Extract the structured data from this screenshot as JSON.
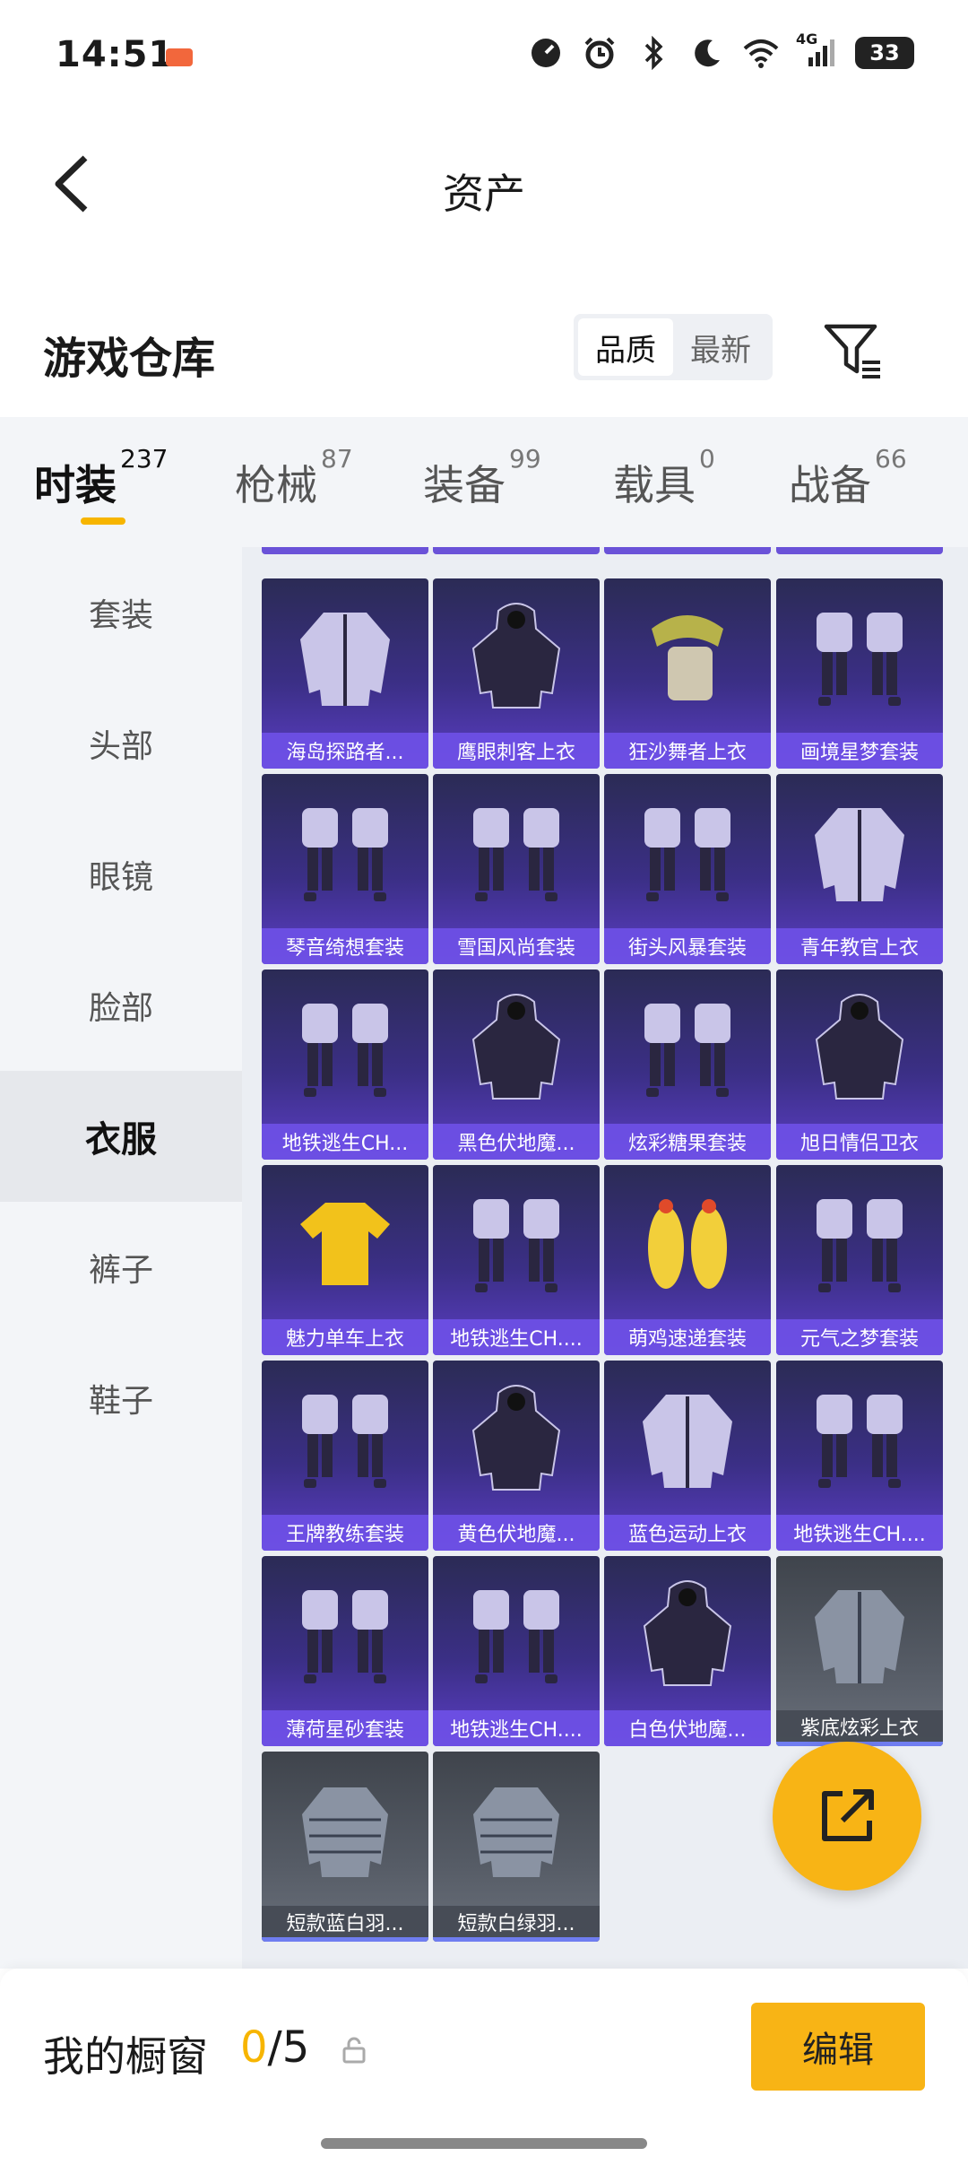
{
  "status_bar": {
    "time": "14:51",
    "network": "4G",
    "battery": "33"
  },
  "nav": {
    "title": "资产"
  },
  "warehouse": {
    "title": "游戏仓库",
    "sort_options": [
      "品质",
      "最新"
    ],
    "sort_active": "品质"
  },
  "tabs": [
    {
      "label": "时装",
      "count": "237",
      "active": true
    },
    {
      "label": "枪械",
      "count": "87",
      "active": false
    },
    {
      "label": "装备",
      "count": "99",
      "active": false
    },
    {
      "label": "载具",
      "count": "0",
      "active": false
    },
    {
      "label": "战备",
      "count": "66",
      "active": false
    }
  ],
  "sidebar": {
    "items": [
      {
        "label": "套装",
        "active": false
      },
      {
        "label": "头部",
        "active": false
      },
      {
        "label": "眼镜",
        "active": false
      },
      {
        "label": "脸部",
        "active": false
      },
      {
        "label": "衣服",
        "active": true
      },
      {
        "label": "裤子",
        "active": false
      },
      {
        "label": "鞋子",
        "active": false
      }
    ]
  },
  "items": [
    {
      "name": "海岛探路者...",
      "icon": "jacket-icon",
      "rarity": "epic"
    },
    {
      "name": "鹰眼刺客上衣",
      "icon": "hoodie-icon",
      "rarity": "epic"
    },
    {
      "name": "狂沙舞者上衣",
      "icon": "scarf-icon",
      "rarity": "epic"
    },
    {
      "name": "画境星梦套装",
      "icon": "outfit-icon",
      "rarity": "epic"
    },
    {
      "name": "琴音绮想套装",
      "icon": "outfit-icon",
      "rarity": "epic"
    },
    {
      "name": "雪国风尚套装",
      "icon": "outfit-icon",
      "rarity": "epic"
    },
    {
      "name": "街头风暴套装",
      "icon": "outfit-icon",
      "rarity": "epic"
    },
    {
      "name": "青年教官上衣",
      "icon": "jacket-icon",
      "rarity": "epic"
    },
    {
      "name": "地铁逃生CH...",
      "icon": "outfit-icon",
      "rarity": "epic"
    },
    {
      "name": "黑色伏地魔...",
      "icon": "hoodie-icon",
      "rarity": "epic"
    },
    {
      "name": "炫彩糖果套装",
      "icon": "outfit-icon",
      "rarity": "epic"
    },
    {
      "name": "旭日情侣卫衣",
      "icon": "hoodie-icon",
      "rarity": "epic"
    },
    {
      "name": "魅力单车上衣",
      "icon": "shirt-icon",
      "rarity": "epic"
    },
    {
      "name": "地铁逃生CH....",
      "icon": "outfit-icon",
      "rarity": "epic"
    },
    {
      "name": "萌鸡速递套装",
      "icon": "chicken-suit-icon",
      "rarity": "epic"
    },
    {
      "name": "元气之梦套装",
      "icon": "outfit-icon",
      "rarity": "epic"
    },
    {
      "name": "王牌教练套装",
      "icon": "outfit-icon",
      "rarity": "epic"
    },
    {
      "name": "黄色伏地魔...",
      "icon": "hoodie-icon",
      "rarity": "epic"
    },
    {
      "name": "蓝色运动上衣",
      "icon": "jacket-icon",
      "rarity": "epic"
    },
    {
      "name": "地铁逃生CH....",
      "icon": "outfit-icon",
      "rarity": "epic"
    },
    {
      "name": "薄荷星砂套装",
      "icon": "outfit-icon",
      "rarity": "epic"
    },
    {
      "name": "地铁逃生CH....",
      "icon": "outfit-icon",
      "rarity": "epic"
    },
    {
      "name": "白色伏地魔...",
      "icon": "hoodie-icon",
      "rarity": "epic"
    },
    {
      "name": "紫底炫彩上衣",
      "icon": "jacket-icon",
      "rarity": "rare"
    },
    {
      "name": "短款蓝白羽...",
      "icon": "puffer-jacket-icon",
      "rarity": "rare"
    },
    {
      "name": "短款白绿羽...",
      "icon": "puffer-jacket-icon",
      "rarity": "rare"
    }
  ],
  "showcase": {
    "label": "我的橱窗",
    "used": "0",
    "separator": "/",
    "total": "5"
  },
  "edit_button": "编辑",
  "colors": {
    "accent": "#f8b415",
    "epic_label": "#6e50e6",
    "rare_label": "#464b54"
  }
}
